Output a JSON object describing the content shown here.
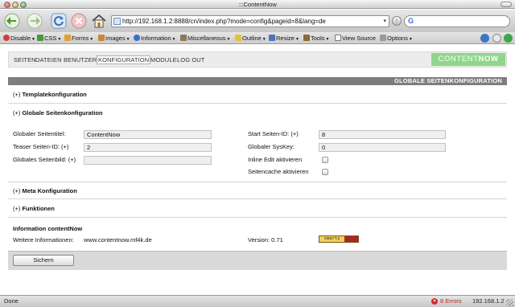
{
  "window": {
    "title": ":::ContentNow"
  },
  "browser": {
    "url": "http://192.168.1.2:8888/cn/index.php?mode=config&pageid=8&lang=de",
    "search_placeholder": ""
  },
  "devtoolbar": {
    "items": [
      "Disable",
      "CSS",
      "Forms",
      "Images",
      "Information",
      "Miscellaneous",
      "Outline",
      "Resize",
      "Tools",
      "View Source",
      "Options"
    ]
  },
  "site": {
    "nav": [
      "SEITEN",
      "DATEIEN",
      "BENUTZER",
      "KONFIGURATION",
      "MODULE",
      "LOG OUT"
    ],
    "active_nav": "KONFIGURATION",
    "brand_light": "CONTENT",
    "brand_bold": "NOW"
  },
  "config": {
    "section_title": "GLOBALE SEITENKONFIGURATION",
    "template_heading_prefix": "(+)",
    "template_heading": "Templatekonfiguration",
    "global_heading_prefix": "(+)",
    "global_heading": "Globale Seitenkonfiguration",
    "fields": {
      "seitentitel_label": "Globaler Seitentitel:",
      "seitentitel_value": "ContentNow",
      "teaser_label": "Teaser Seiten-ID: (+)",
      "teaser_value": "2",
      "seitenbild_label": "Globales Seitenbild: (+)",
      "seitenbild_value": "",
      "start_label": "Start Seiten-ID: (+)",
      "start_value": "8",
      "syskey_label": "Globaler SysKey:",
      "syskey_value": "0",
      "inline_label": "Inline Edit aktivieren",
      "cache_label": "Seitencache aktivieren"
    },
    "meta_heading_prefix": "(+)",
    "meta_heading": "Meta Konfiguration",
    "funktionen_heading_prefix": "(+)",
    "funktionen_heading": "Funktionen",
    "info_title": "Information contentNow",
    "info_label": "Weitere Informationen:",
    "info_link": "www.contentnow.mf4k.de",
    "version": "Version: 0.71",
    "smarty_left": "smarty",
    "smarty_right": "",
    "save_button": "Sichern"
  },
  "status": {
    "left": "Done",
    "errors": "8 Errors",
    "ip": "192.168.1.2"
  }
}
